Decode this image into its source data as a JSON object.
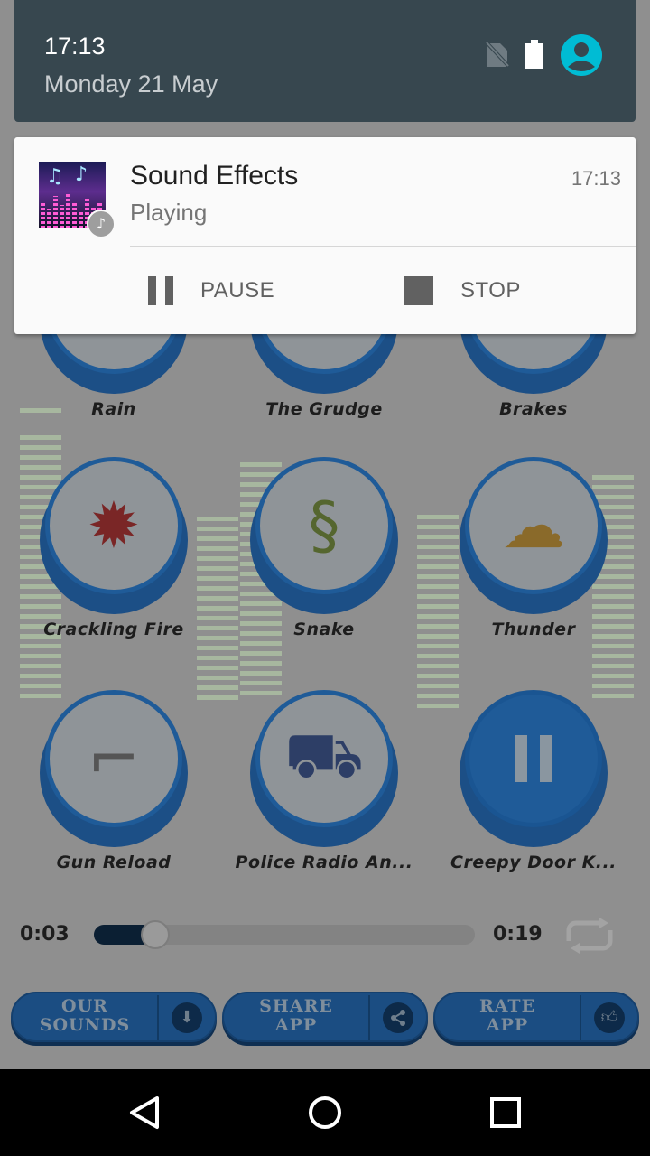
{
  "status_panel": {
    "time": "17:13",
    "date": "Monday 21 May"
  },
  "notification": {
    "app_name": "Sound Effects",
    "status": "Playing",
    "time": "17:13",
    "actions": [
      {
        "label": "PAUSE",
        "icon": "pause-icon"
      },
      {
        "label": "STOP",
        "icon": "stop-icon"
      }
    ]
  },
  "sounds": [
    {
      "label": "Rain",
      "icon": "rain-icon"
    },
    {
      "label": "The Grudge",
      "icon": "grudge-icon"
    },
    {
      "label": "Brakes",
      "icon": "tire-tracks-icon"
    },
    {
      "label": "Crackling Fire",
      "icon": "firecracker-icon"
    },
    {
      "label": "Snake",
      "icon": "snake-icon"
    },
    {
      "label": "Thunder",
      "icon": "thunder-cloud-icon"
    },
    {
      "label": "Gun Reload",
      "icon": "revolver-icon"
    },
    {
      "label": "Police Radio An...",
      "icon": "police-car-icon"
    },
    {
      "label": "Creepy Door K...",
      "icon": "pause-icon"
    }
  ],
  "player": {
    "elapsed": "0:03",
    "duration": "0:19",
    "progress": 0.16
  },
  "bottom_buttons": [
    {
      "line1": "OUR",
      "line2": "SOUNDS",
      "icon": "download-icon"
    },
    {
      "line1": "SHARE",
      "line2": "APP",
      "icon": "share-icon"
    },
    {
      "line1": "RATE",
      "line2": "APP",
      "icon": "thumbs-up-icon"
    }
  ],
  "colors": {
    "shade_header": "#37474f",
    "notification_card": "#fafafa",
    "account_accent": "#00bcd4",
    "app_button_blue": "#1f5b98"
  }
}
